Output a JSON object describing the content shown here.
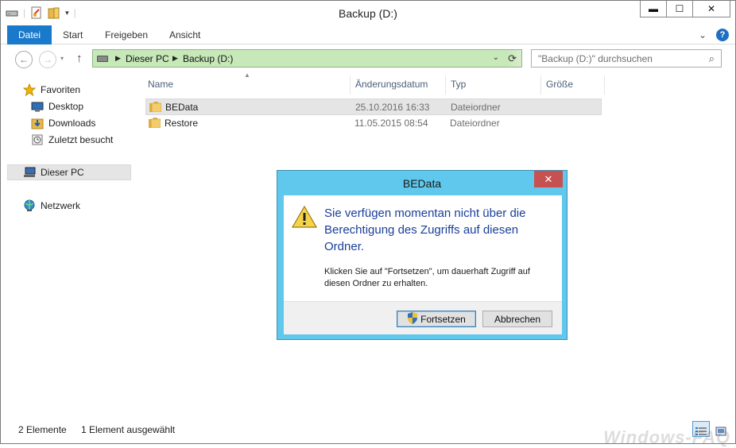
{
  "window": {
    "title": "Backup (D:)",
    "controls": {
      "minimize": "▬",
      "maximize": "☐",
      "close": "✕"
    }
  },
  "ribbon": {
    "tabs": [
      "Datei",
      "Start",
      "Freigeben",
      "Ansicht"
    ],
    "collapse_icon": "chevron-down-icon",
    "help_label": "?"
  },
  "address": {
    "crumbs": [
      "Dieser PC",
      "Backup (D:)"
    ],
    "search_placeholder": "\"Backup (D:)\" durchsuchen",
    "accent": "#c7e8b8"
  },
  "sidebar": {
    "items": [
      {
        "label": "Favoriten",
        "icon": "star-icon"
      },
      {
        "label": "Desktop",
        "icon": "desktop-icon"
      },
      {
        "label": "Downloads",
        "icon": "downloads-icon"
      },
      {
        "label": "Zuletzt besucht",
        "icon": "recent-icon"
      },
      {
        "label": "Dieser PC",
        "icon": "computer-icon"
      },
      {
        "label": "Netzwerk",
        "icon": "network-icon"
      }
    ]
  },
  "columns": [
    "Name",
    "Änderungsdatum",
    "Typ",
    "Größe"
  ],
  "files": [
    {
      "name": "BEData",
      "date": "25.10.2016 16:33",
      "type": "Dateiordner",
      "selected": true
    },
    {
      "name": "Restore",
      "date": "11.05.2015 08:54",
      "type": "Dateiordner",
      "selected": false
    }
  ],
  "status": {
    "count": "2 Elemente",
    "selection": "1 Element ausgewählt"
  },
  "watermark": "Windows-FAQ",
  "dialog": {
    "title": "BEData",
    "close_label": "✕",
    "message": "Sie verfügen momentan nicht über die Berechtigung des Zugriffs auf diesen Ordner.",
    "detail": "Klicken Sie auf \"Fortsetzen\", um dauerhaft Zugriff auf diesen Ordner zu erhalten.",
    "continue_label": "Fortsetzen",
    "cancel_label": "Abbrechen",
    "accent": "#5fc8ec"
  }
}
